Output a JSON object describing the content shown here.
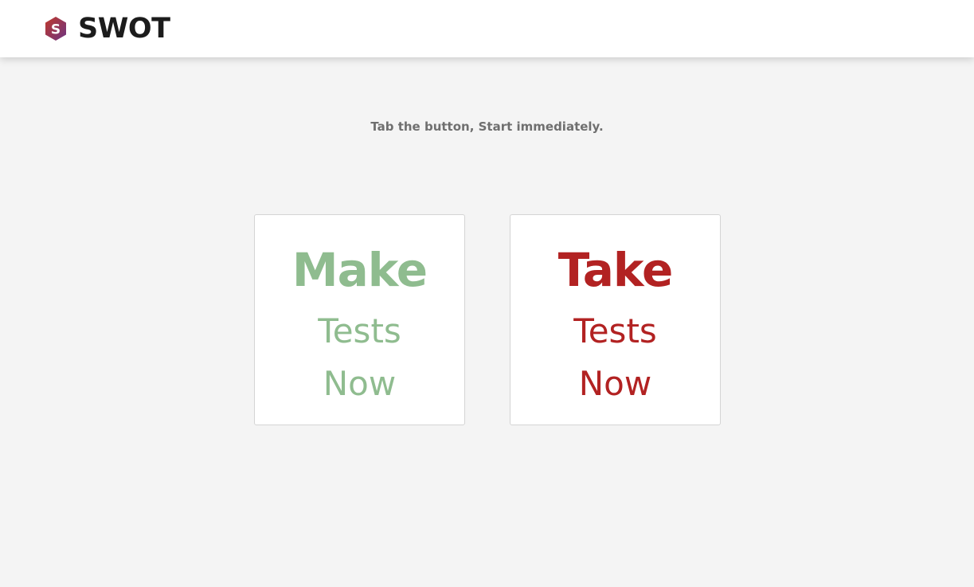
{
  "header": {
    "brand_name": "SWOT",
    "logo_icon": "swot-hexagon-logo-icon",
    "logo_letter": "S"
  },
  "main": {
    "tagline": "Tab the button, Start immediately.",
    "cards": [
      {
        "big": "Make",
        "mid": "Tests",
        "low": "Now",
        "color": "#8fbc8f"
      },
      {
        "big": "Take",
        "mid": "Tests",
        "low": "Now",
        "color": "#b22222"
      }
    ]
  },
  "colors": {
    "make_accent": "#8fbc8f",
    "take_accent": "#b22222",
    "logo_gradient_start": "#c0392b",
    "logo_gradient_end": "#6c3483"
  }
}
